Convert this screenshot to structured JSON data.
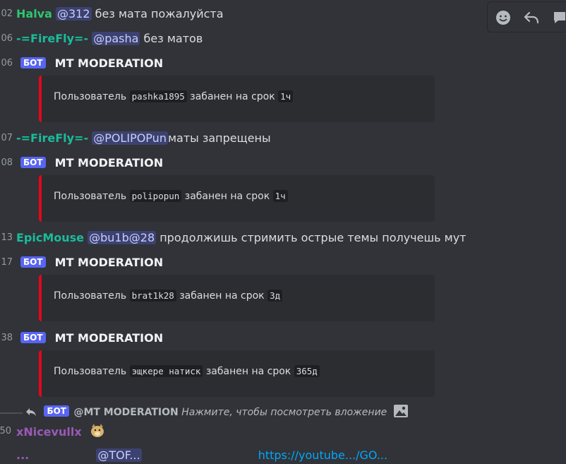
{
  "messages": [
    {
      "time": ":02",
      "author": "Halva",
      "mention": "@312",
      "text": "без мата пожалуйста",
      "color": "#2dc770"
    },
    {
      "time": ":06",
      "author": "-=FireFly=-",
      "mention": "@pasha",
      "text": "без матов",
      "color": "#1abc9c"
    },
    {
      "time": ":06",
      "bot_badge": "БОТ",
      "bot_name": "MT MODERATION",
      "embed": {
        "prefix": "Пользователь",
        "user": "pashka1895",
        "mid": "забанен на срок",
        "duration": "1ч"
      }
    },
    {
      "time": ":07",
      "author": "-=FireFly=-",
      "mention": "@POLIPOPun",
      "text": "маты запрещены",
      "color": "#1abc9c"
    },
    {
      "time": ":08",
      "bot_badge": "БОТ",
      "bot_name": "MT MODERATION",
      "embed": {
        "prefix": "Пользователь",
        "user": "polipopun",
        "mid": "забанен на срок",
        "duration": "1ч"
      }
    },
    {
      "time": ":13",
      "author": "EpicMouse",
      "mention": "@bu1b@28",
      "text": "продолжишь стримить острые темы получешь мут",
      "color": "#1abc9c"
    },
    {
      "time": ":17",
      "bot_badge": "БОТ",
      "bot_name": "MT MODERATION",
      "embed": {
        "prefix": "Пользователь",
        "user": "brat1k28",
        "mid": "забанен на срок",
        "duration": "3д"
      }
    },
    {
      "time": ":38",
      "bot_badge": "БОТ",
      "bot_name": "MT MODERATION",
      "embed": {
        "prefix": "Пользователь",
        "user": "эщкере натиск",
        "mid": "забанен на срок",
        "duration": "365д"
      }
    }
  ],
  "reply": {
    "badge": "БОТ",
    "mention": "@MT MODERATION",
    "hint": "Нажмите, чтобы посмотреть вложение"
  },
  "last_message": {
    "time": ":50",
    "author": "xNicevullx",
    "color": "#9b59b6"
  },
  "cut_line": {
    "author": "...",
    "mention": "@TOF...",
    "link": "https://youtube.../GO..."
  },
  "toolbar": {
    "icons": [
      "add-reaction-icon",
      "reply-icon",
      "more-icon"
    ]
  }
}
